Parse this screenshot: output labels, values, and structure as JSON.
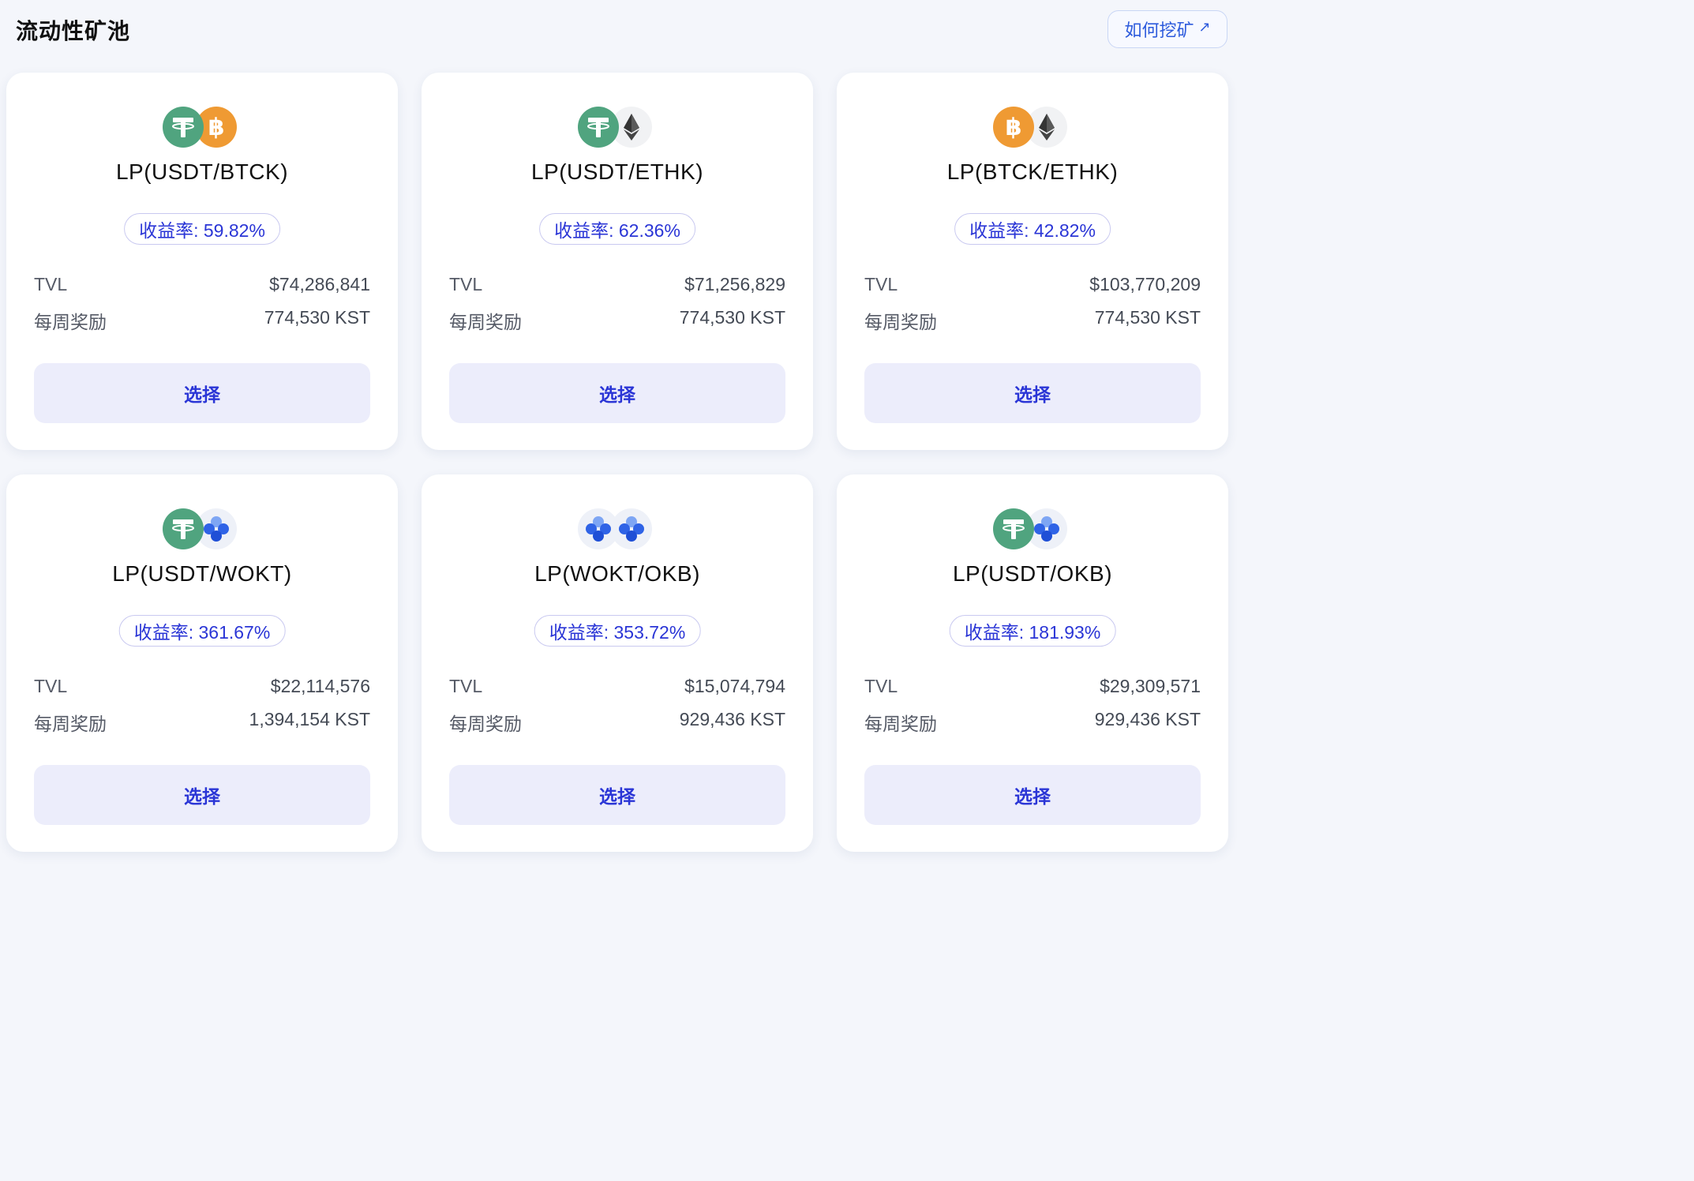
{
  "header": {
    "title": "流动性矿池",
    "how_to_mine_label": "如何挖矿",
    "how_to_mine_icon": "external-arrow-icon"
  },
  "colors": {
    "usdt": "#50a47f",
    "btc": "#ef9a33",
    "eth_bg": "#f1f2f4",
    "okb_bg": "#eef1f8",
    "okb": "#2f63e6",
    "accent": "#2a35d6",
    "button_bg": "#ecedfb"
  },
  "pools": [
    {
      "pair": "LP(USDT/BTCK)",
      "apr": "收益率: 59.82%",
      "tvl_label": "TVL",
      "tvl": "$74,286,841",
      "reward_label": "每周奖励",
      "reward": "774,530 KST",
      "select_label": "选择",
      "icons": [
        "usdt-icon",
        "btc-icon"
      ]
    },
    {
      "pair": "LP(USDT/ETHK)",
      "apr": "收益率: 62.36%",
      "tvl_label": "TVL",
      "tvl": "$71,256,829",
      "reward_label": "每周奖励",
      "reward": "774,530 KST",
      "select_label": "选择",
      "icons": [
        "usdt-icon",
        "eth-icon"
      ]
    },
    {
      "pair": "LP(BTCK/ETHK)",
      "apr": "收益率: 42.82%",
      "tvl_label": "TVL",
      "tvl": "$103,770,209",
      "reward_label": "每周奖励",
      "reward": "774,530 KST",
      "select_label": "选择",
      "icons": [
        "btc-icon",
        "eth-icon"
      ]
    },
    {
      "pair": "LP(USDT/WOKT)",
      "apr": "收益率: 361.67%",
      "tvl_label": "TVL",
      "tvl": "$22,114,576",
      "reward_label": "每周奖励",
      "reward": "1,394,154 KST",
      "select_label": "选择",
      "icons": [
        "usdt-icon",
        "okx-icon"
      ]
    },
    {
      "pair": "LP(WOKT/OKB)",
      "apr": "收益率: 353.72%",
      "tvl_label": "TVL",
      "tvl": "$15,074,794",
      "reward_label": "每周奖励",
      "reward": "929,436 KST",
      "select_label": "选择",
      "icons": [
        "okx-icon",
        "okx-icon"
      ]
    },
    {
      "pair": "LP(USDT/OKB)",
      "apr": "收益率: 181.93%",
      "tvl_label": "TVL",
      "tvl": "$29,309,571",
      "reward_label": "每周奖励",
      "reward": "929,436 KST",
      "select_label": "选择",
      "icons": [
        "usdt-icon",
        "okx-icon"
      ]
    }
  ]
}
